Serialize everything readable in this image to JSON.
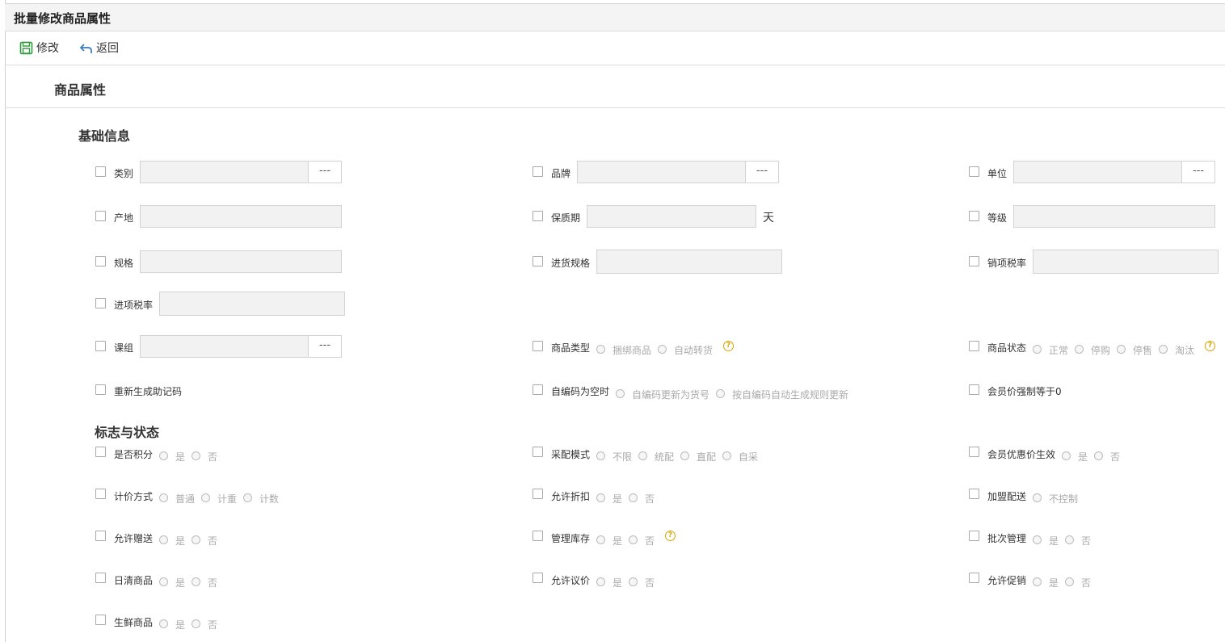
{
  "window": {
    "title": "批量修改商品属性"
  },
  "toolbar": {
    "modify": "修改",
    "back": "返回",
    "save_icon_color": "#2e9b3a",
    "back_icon_color": "#3a78c2"
  },
  "section": {
    "title": "商品属性"
  },
  "basic": {
    "title": "基础信息",
    "category": "类别",
    "brand": "品牌",
    "unit": "单位",
    "origin": "产地",
    "shelf_life": "保质期",
    "shelf_life_unit": "天",
    "grade": "等级",
    "spec": "规格",
    "purchase_spec": "进货规格",
    "output_tax": "销项税率",
    "input_tax": "进项税率",
    "course_group": "课组",
    "lookup_btn": "---",
    "product_type": {
      "label": "商品类型",
      "options": [
        "捆绑商品",
        "自动转货"
      ]
    },
    "product_status": {
      "label": "商品状态",
      "options": [
        "正常",
        "停购",
        "停售",
        "淘汰"
      ]
    },
    "regen_mnemonic": "重新生成助记码",
    "self_code_empty": {
      "label": "自编码为空时",
      "options": [
        "自编码更新为货号",
        "按自编码自动生成规则更新"
      ]
    },
    "member_price_zero": "会员价强制等于0"
  },
  "flags": {
    "title": "标志与状态",
    "points": {
      "label": "是否积分",
      "options": [
        "是",
        "否"
      ]
    },
    "purchase_mode": {
      "label": "采配模式",
      "options": [
        "不限",
        "统配",
        "直配",
        "自采"
      ]
    },
    "member_discount": {
      "label": "会员优惠价生效",
      "options": [
        "是",
        "否"
      ]
    },
    "pricing": {
      "label": "计价方式",
      "options": [
        "普通",
        "计重",
        "计数"
      ]
    },
    "allow_discount": {
      "label": "允许折扣",
      "options": [
        "是",
        "否"
      ]
    },
    "franchise_delivery": {
      "label": "加盟配送",
      "options": [
        "不控制"
      ]
    },
    "allow_gift": {
      "label": "允许赠送",
      "options": [
        "是",
        "否"
      ]
    },
    "manage_stock": {
      "label": "管理库存",
      "options": [
        "是",
        "否"
      ]
    },
    "batch_manage": {
      "label": "批次管理",
      "options": [
        "是",
        "否"
      ]
    },
    "daily_clear": {
      "label": "日清商品",
      "options": [
        "是",
        "否"
      ]
    },
    "allow_bargain": {
      "label": "允许议价",
      "options": [
        "是",
        "否"
      ]
    },
    "allow_promo": {
      "label": "允许促销",
      "options": [
        "是",
        "否"
      ]
    },
    "fresh": {
      "label": "生鲜商品",
      "options": [
        "是",
        "否"
      ]
    }
  },
  "help_glyph": "?"
}
